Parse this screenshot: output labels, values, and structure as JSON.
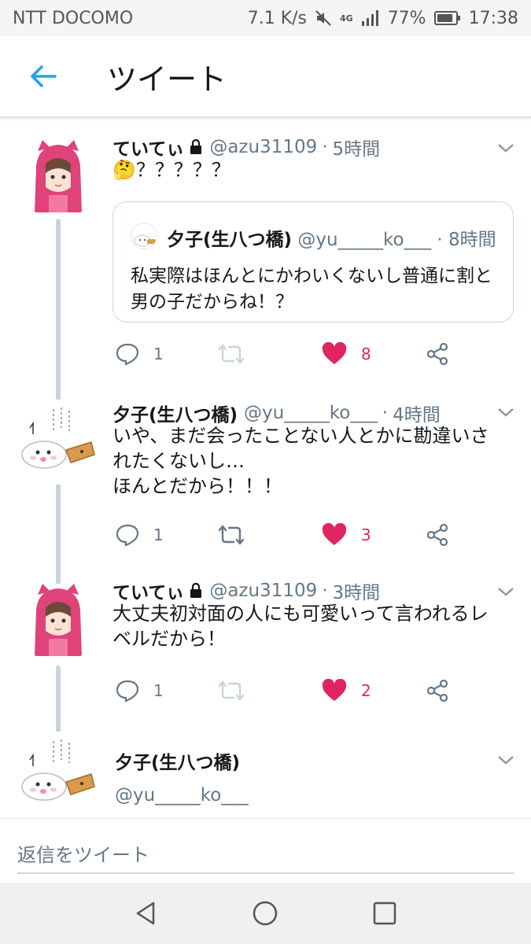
{
  "status_bar": {
    "carrier": "NTT DOCOMO",
    "speed": "7.1 K/s",
    "network": "4G",
    "battery": "77%",
    "time": "17:38"
  },
  "app_bar": {
    "title": "ツイート"
  },
  "tweets": [
    {
      "name": "ていてぃ",
      "handle": "@azu31109",
      "time": "5時間",
      "locked": true,
      "text": "🤔？？？？？",
      "quote": {
        "name": "夕子(生八つ橋)",
        "handle": "@yu_____ko___",
        "time": "8時間",
        "text": "私実際はほんとにかわいくないし普通に割と男の子だからね！？"
      },
      "replies": "1",
      "retweets": "",
      "likes": "8"
    },
    {
      "name": "夕子(生八つ橋)",
      "handle": "@yu_____ko___",
      "time": "4時間",
      "locked": false,
      "text": "いや、まだ会ったことない人とかに勘違いされたくないし…\nほんとだから！！！",
      "replies": "1",
      "retweets": "",
      "likes": "3"
    },
    {
      "name": "ていてぃ",
      "handle": "@azu31109",
      "time": "3時間",
      "locked": true,
      "text": "大丈夫初対面の人にも可愛いって言われるレベルだから！",
      "replies": "1",
      "retweets": "",
      "likes": "2"
    },
    {
      "name": "夕子(生八つ橋)",
      "handle": "@yu_____ko___"
    }
  ],
  "reply_bar": {
    "placeholder": "返信をツイート"
  },
  "colors": {
    "accent": "#1da1f2",
    "like": "#e0245e",
    "muted": "#657786",
    "thread_line": "#c9d3dc"
  },
  "icons": {
    "back": "arrow-left-icon",
    "reply": "reply-icon",
    "retweet": "retweet-icon",
    "like": "heart-icon",
    "share": "share-icon",
    "more": "chevron-down-icon",
    "lock": "lock-icon"
  }
}
